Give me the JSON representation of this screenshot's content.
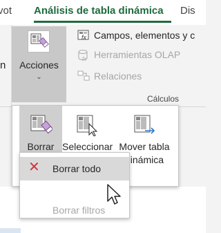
{
  "tabs": {
    "left_partial": "vot",
    "active": "Análisis de tabla dinámica",
    "right_partial": "Dis"
  },
  "ribbon": {
    "left_partial_label": "n",
    "acciones_label": "Acciones",
    "commands": [
      {
        "label": "Campos, elementos y c",
        "icon": "fields-items-sets-icon",
        "enabled": true
      },
      {
        "label": "Herramientas OLAP",
        "icon": "olap-tools-icon",
        "enabled": false
      },
      {
        "label": "Relaciones",
        "icon": "relationships-icon",
        "enabled": false
      }
    ],
    "group_label": "Cálculos"
  },
  "flyout": {
    "borrar_label": "Borrar",
    "seleccionar_label": "Seleccionar",
    "mover_label_line1": "Mover tabla",
    "mover_label_line2": "dinámica"
  },
  "sheet": {
    "column_header": "K"
  },
  "submenu": {
    "items": [
      {
        "label": "Borrar todo",
        "icon": "clear-x-icon",
        "enabled": true
      },
      {
        "label": "Borrar filtros",
        "enabled": false
      }
    ]
  },
  "colors": {
    "accent_green": "#1e6b3c",
    "clear_red": "#d13438",
    "disabled_text": "#a6a6a6"
  }
}
